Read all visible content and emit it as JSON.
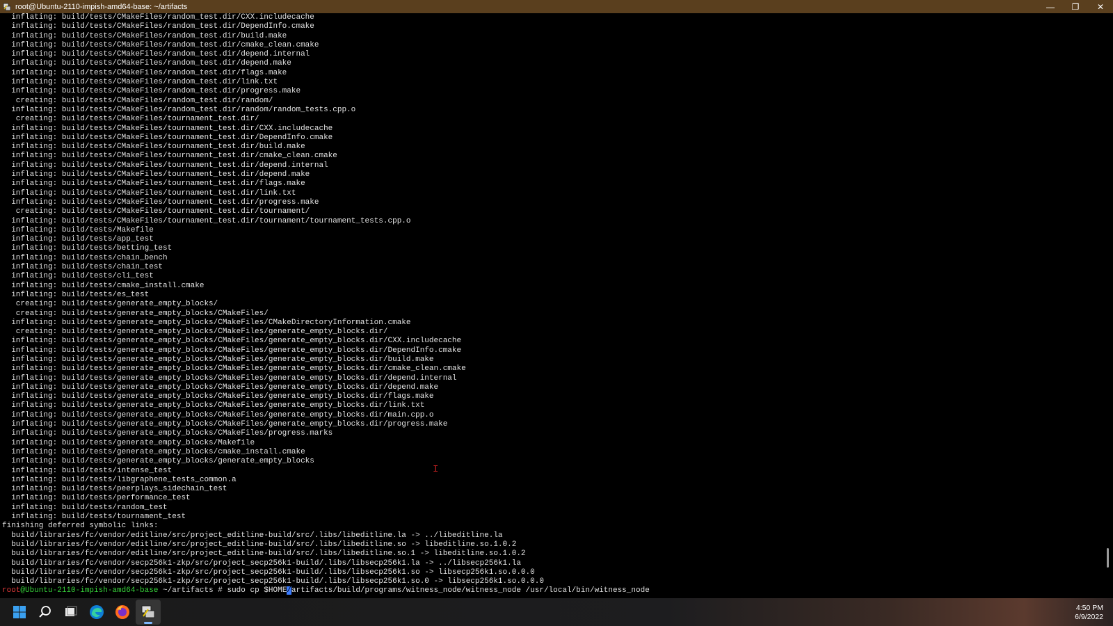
{
  "window": {
    "title": "root@Ubuntu-2110-impish-amd64-base: ~/artifacts",
    "minimize_label": "—",
    "maximize_label": "❐",
    "close_label": "✕"
  },
  "terminal": {
    "lines": [
      "  inflating: build/tests/CMakeFiles/random_test.dir/CXX.includecache",
      "  inflating: build/tests/CMakeFiles/random_test.dir/DependInfo.cmake",
      "  inflating: build/tests/CMakeFiles/random_test.dir/build.make",
      "  inflating: build/tests/CMakeFiles/random_test.dir/cmake_clean.cmake",
      "  inflating: build/tests/CMakeFiles/random_test.dir/depend.internal",
      "  inflating: build/tests/CMakeFiles/random_test.dir/depend.make",
      "  inflating: build/tests/CMakeFiles/random_test.dir/flags.make",
      "  inflating: build/tests/CMakeFiles/random_test.dir/link.txt",
      "  inflating: build/tests/CMakeFiles/random_test.dir/progress.make",
      "   creating: build/tests/CMakeFiles/random_test.dir/random/",
      "  inflating: build/tests/CMakeFiles/random_test.dir/random/random_tests.cpp.o",
      "   creating: build/tests/CMakeFiles/tournament_test.dir/",
      "  inflating: build/tests/CMakeFiles/tournament_test.dir/CXX.includecache",
      "  inflating: build/tests/CMakeFiles/tournament_test.dir/DependInfo.cmake",
      "  inflating: build/tests/CMakeFiles/tournament_test.dir/build.make",
      "  inflating: build/tests/CMakeFiles/tournament_test.dir/cmake_clean.cmake",
      "  inflating: build/tests/CMakeFiles/tournament_test.dir/depend.internal",
      "  inflating: build/tests/CMakeFiles/tournament_test.dir/depend.make",
      "  inflating: build/tests/CMakeFiles/tournament_test.dir/flags.make",
      "  inflating: build/tests/CMakeFiles/tournament_test.dir/link.txt",
      "  inflating: build/tests/CMakeFiles/tournament_test.dir/progress.make",
      "   creating: build/tests/CMakeFiles/tournament_test.dir/tournament/",
      "  inflating: build/tests/CMakeFiles/tournament_test.dir/tournament/tournament_tests.cpp.o",
      "  inflating: build/tests/Makefile",
      "  inflating: build/tests/app_test",
      "  inflating: build/tests/betting_test",
      "  inflating: build/tests/chain_bench",
      "  inflating: build/tests/chain_test",
      "  inflating: build/tests/cli_test",
      "  inflating: build/tests/cmake_install.cmake",
      "  inflating: build/tests/es_test",
      "   creating: build/tests/generate_empty_blocks/",
      "   creating: build/tests/generate_empty_blocks/CMakeFiles/",
      "  inflating: build/tests/generate_empty_blocks/CMakeFiles/CMakeDirectoryInformation.cmake",
      "   creating: build/tests/generate_empty_blocks/CMakeFiles/generate_empty_blocks.dir/",
      "  inflating: build/tests/generate_empty_blocks/CMakeFiles/generate_empty_blocks.dir/CXX.includecache",
      "  inflating: build/tests/generate_empty_blocks/CMakeFiles/generate_empty_blocks.dir/DependInfo.cmake",
      "  inflating: build/tests/generate_empty_blocks/CMakeFiles/generate_empty_blocks.dir/build.make",
      "  inflating: build/tests/generate_empty_blocks/CMakeFiles/generate_empty_blocks.dir/cmake_clean.cmake",
      "  inflating: build/tests/generate_empty_blocks/CMakeFiles/generate_empty_blocks.dir/depend.internal",
      "  inflating: build/tests/generate_empty_blocks/CMakeFiles/generate_empty_blocks.dir/depend.make",
      "  inflating: build/tests/generate_empty_blocks/CMakeFiles/generate_empty_blocks.dir/flags.make",
      "  inflating: build/tests/generate_empty_blocks/CMakeFiles/generate_empty_blocks.dir/link.txt",
      "  inflating: build/tests/generate_empty_blocks/CMakeFiles/generate_empty_blocks.dir/main.cpp.o",
      "  inflating: build/tests/generate_empty_blocks/CMakeFiles/generate_empty_blocks.dir/progress.make",
      "  inflating: build/tests/generate_empty_blocks/CMakeFiles/progress.marks",
      "  inflating: build/tests/generate_empty_blocks/Makefile",
      "  inflating: build/tests/generate_empty_blocks/cmake_install.cmake",
      "  inflating: build/tests/generate_empty_blocks/generate_empty_blocks",
      "  inflating: build/tests/intense_test",
      "  inflating: build/tests/libgraphene_tests_common.a",
      "  inflating: build/tests/peerplays_sidechain_test",
      "  inflating: build/tests/performance_test",
      "  inflating: build/tests/random_test",
      "  inflating: build/tests/tournament_test",
      "finishing deferred symbolic links:",
      "  build/libraries/fc/vendor/editline/src/project_editline-build/src/.libs/libeditline.la -> ../libeditline.la",
      "  build/libraries/fc/vendor/editline/src/project_editline-build/src/.libs/libeditline.so -> libeditline.so.1.0.2",
      "  build/libraries/fc/vendor/editline/src/project_editline-build/src/.libs/libeditline.so.1 -> libeditline.so.1.0.2",
      "  build/libraries/fc/vendor/secp256k1-zkp/src/project_secp256k1-build/.libs/libsecp256k1.la -> ../libsecp256k1.la",
      "  build/libraries/fc/vendor/secp256k1-zkp/src/project_secp256k1-build/.libs/libsecp256k1.so -> libsecp256k1.so.0.0.0",
      "  build/libraries/fc/vendor/secp256k1-zkp/src/project_secp256k1-build/.libs/libsecp256k1.so.0 -> libsecp256k1.so.0.0.0"
    ],
    "prompt": {
      "user": "root",
      "at_host": "@Ubuntu-2110-impish-amd64-base",
      "path": " ~/artifacts #",
      "command_before_cursor": " sudo cp $HOME",
      "cursor_char": "/",
      "command_after_cursor": "artifacts/build/programs/witness_node/witness_node /usr/local/bin/witness_node"
    },
    "scroll_position": 0.95
  },
  "taskbar": {
    "icons": [
      "windows-start-icon",
      "search-icon",
      "task-view-icon",
      "edge-browser-icon",
      "firefox-icon",
      "putty-icon"
    ],
    "clock_time": "4:50 PM",
    "clock_date": "6/9/2022"
  }
}
